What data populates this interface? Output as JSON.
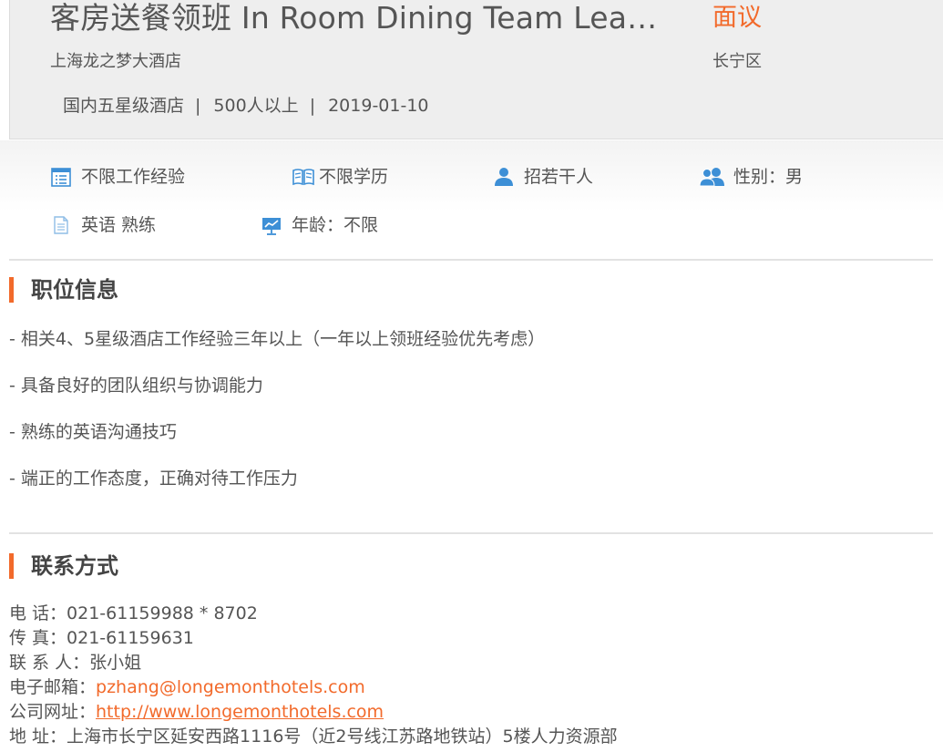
{
  "header": {
    "title": "客房送餐领班 In Room Dining Team Lea…",
    "salary": "面议",
    "company": "上海龙之梦大酒店",
    "district": "长宁区",
    "meta": {
      "company_type": "国内五星级酒店",
      "company_size": "500人以上",
      "date": "2019-01-10",
      "separator": "|"
    }
  },
  "requirements": {
    "experience": "不限工作经验",
    "education": "不限学历",
    "headcount": "招若干人",
    "gender": "性别：男",
    "language": "英语 熟练",
    "age": "年龄：不限"
  },
  "job_info": {
    "title": "职位信息",
    "duties": [
      "- 相关4、5星级酒店工作经验三年以上（一年以上领班经验优先考虑）",
      "- 具备良好的团队组织与协调能力",
      "- 熟练的英语沟通技巧",
      "- 端正的工作态度，正确对待工作压力"
    ]
  },
  "contact": {
    "title": "联系方式",
    "phone_label": "电 话：",
    "phone": "021-61159988 * 8702",
    "fax_label": "传 真：",
    "fax": "021-61159631",
    "person_label": "联 系 人：",
    "person": "张小姐",
    "email_label": "电子邮箱：",
    "email": "pzhang@longemonthotels.com",
    "website_label": "公司网址：",
    "website": "http://www.longemonthotels.com",
    "address_label": "地 址：",
    "address": "上海市长宁区延安西路1116号（近2号线江苏路地铁站）5楼人力资源部"
  },
  "colors": {
    "accent": "#f26a2b",
    "icon_blue": "#3d8fd6",
    "text": "#555555"
  },
  "icons": {
    "experience": "calendar-list-icon",
    "education": "open-book-icon",
    "headcount": "person-icon",
    "gender": "people-icon",
    "language": "document-icon",
    "age": "presentation-chart-icon"
  }
}
